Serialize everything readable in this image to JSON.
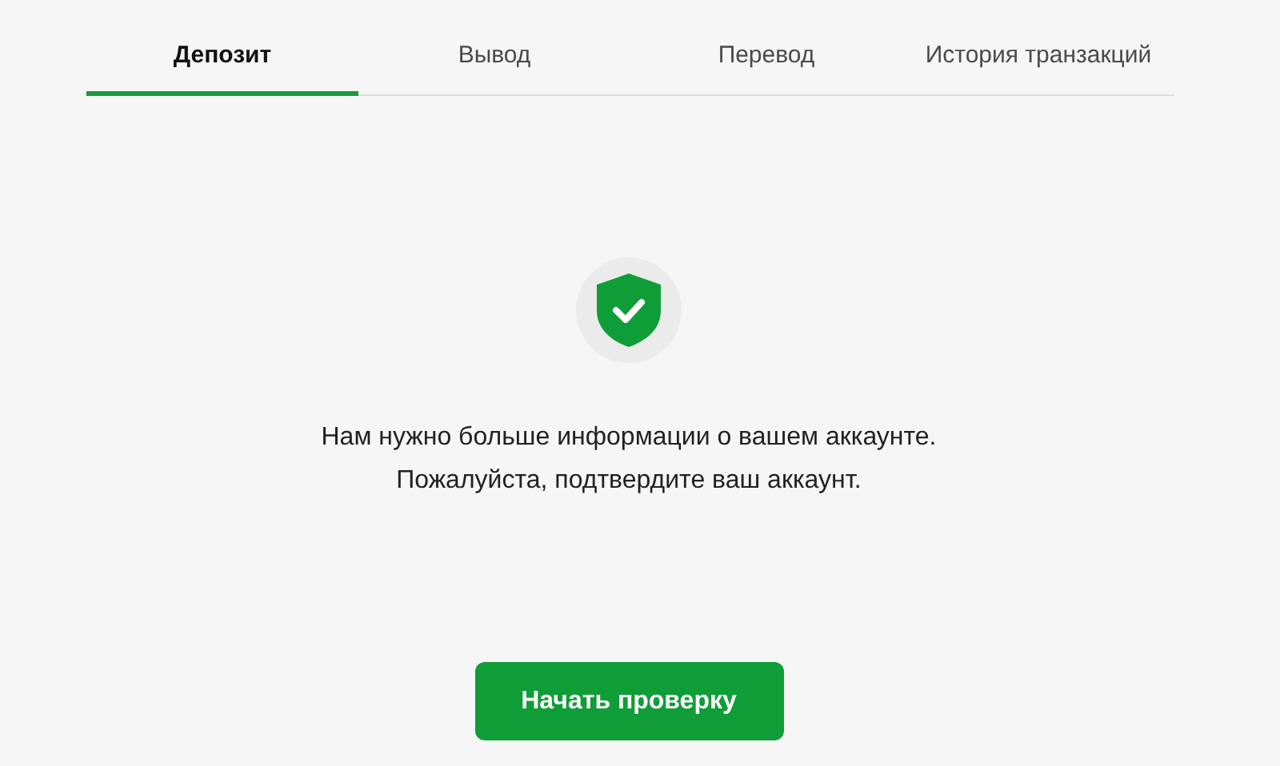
{
  "tabs": [
    {
      "label": "Депозит",
      "selected": true
    },
    {
      "label": "Вывод",
      "selected": false
    },
    {
      "label": "Перевод",
      "selected": false
    },
    {
      "label": "История транзакций",
      "selected": false
    }
  ],
  "message": [
    "Нам нужно больше информации о вашем аккаунте.",
    "Пожалуйста, подтвердите ваш аккаунт."
  ],
  "button": {
    "label": "Начать проверку"
  }
}
